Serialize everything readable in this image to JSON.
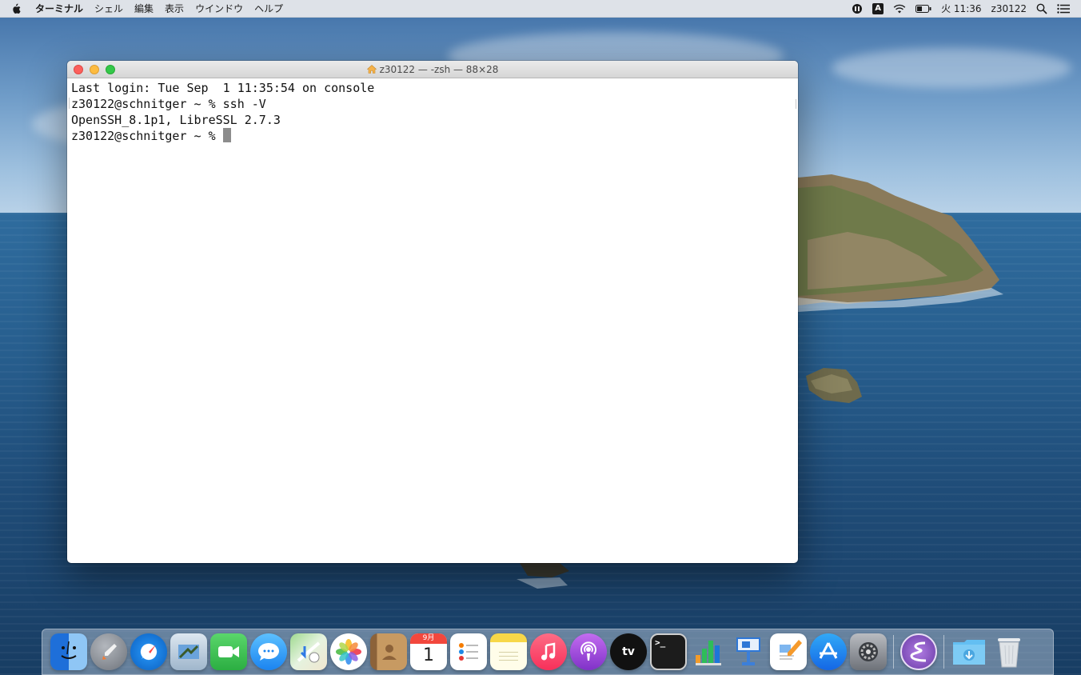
{
  "menubar": {
    "app_name": "ターミナル",
    "items": [
      "シェル",
      "編集",
      "表示",
      "ウインドウ",
      "ヘルプ"
    ],
    "input_mode_label": "A",
    "clock": "火 11:36",
    "user": "z30122"
  },
  "terminal": {
    "title": "z30122 — -zsh — 88×28",
    "lines": [
      "Last login: Tue Sep  1 11:35:54 on console",
      "z30122@schnitger ~ % ssh -V",
      "OpenSSH_8.1p1, LibreSSL 2.7.3",
      "z30122@schnitger ~ % "
    ]
  },
  "dock": {
    "calendar_month": "9月",
    "calendar_day": "1",
    "tv_label": "tv",
    "terminal_prompt": ">_",
    "items": [
      {
        "name": "finder",
        "color": "#3d8be6"
      },
      {
        "name": "launchpad",
        "color": "#8a8f98"
      },
      {
        "name": "safari",
        "color": "#1f87e8"
      },
      {
        "name": "mail",
        "color": "#4a90d9"
      },
      {
        "name": "facetime",
        "color": "#35c24d"
      },
      {
        "name": "messages",
        "color": "#2f9cf4"
      },
      {
        "name": "maps",
        "color": "#6fbf5a"
      },
      {
        "name": "photos",
        "color": "#f4f4f4"
      },
      {
        "name": "contacts",
        "color": "#b58a55"
      },
      {
        "name": "calendar",
        "color": "#ffffff"
      },
      {
        "name": "reminders",
        "color": "#ffffff"
      },
      {
        "name": "notes",
        "color": "#f7d748"
      },
      {
        "name": "music",
        "color": "#fb5c74"
      },
      {
        "name": "podcasts",
        "color": "#9b4fd9"
      },
      {
        "name": "tv",
        "color": "#111111"
      },
      {
        "name": "terminal",
        "color": "#1c1c1c"
      },
      {
        "name": "numbers",
        "color": "#ffffff"
      },
      {
        "name": "keynote",
        "color": "#2e77d6"
      },
      {
        "name": "pages",
        "color": "#f59a2c"
      },
      {
        "name": "app-store",
        "color": "#1c8ef1"
      },
      {
        "name": "system-preferences",
        "color": "#8e8e93"
      },
      {
        "name": "emacs",
        "color": "#7e4fb6"
      },
      {
        "name": "downloads",
        "color": "#4fb3ee"
      },
      {
        "name": "trash",
        "color": "#d9dde2"
      }
    ]
  }
}
